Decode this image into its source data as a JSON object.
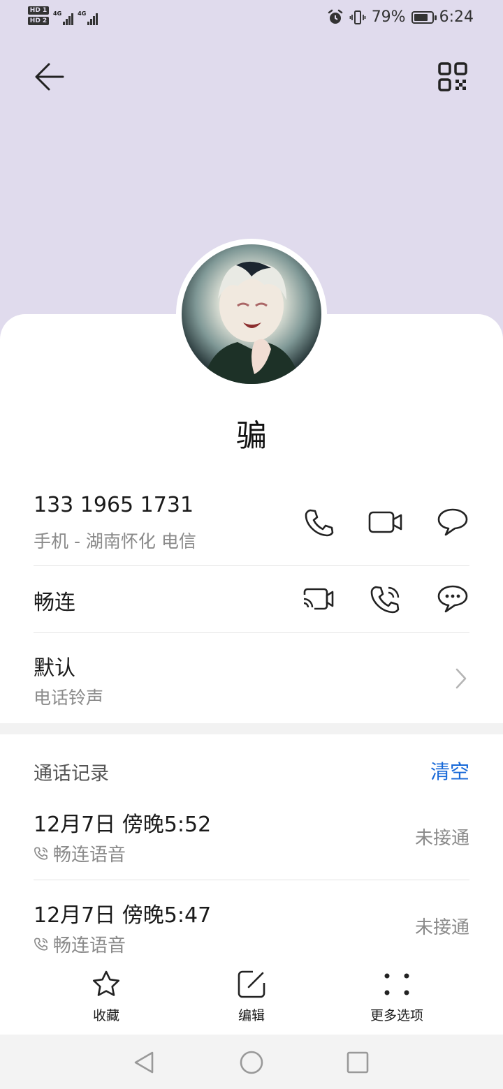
{
  "status_bar": {
    "sim1": "HD 1",
    "sim2": "HD 2",
    "net1": "4G",
    "net2": "4G",
    "battery_percent": "79%",
    "battery_level": 0.79,
    "time": "6:24"
  },
  "header": {
    "back_icon": "arrow-left-icon",
    "qr_icon": "qr-code-icon"
  },
  "contact": {
    "name": "骗",
    "phone_number": "133 1965 1731",
    "phone_label": "手机 - 湖南怀化 电信",
    "changlian_label": "畅连",
    "ringtone_value": "默认",
    "ringtone_label": "电话铃声"
  },
  "call_log": {
    "title": "通话记录",
    "clear_label": "清空",
    "entries": [
      {
        "time": "12月7日 傍晚5:52",
        "type": "畅连语音",
        "status": "未接通"
      },
      {
        "time": "12月7日 傍晚5:47",
        "type": "畅连语音",
        "status": "未接通"
      }
    ]
  },
  "bottom_actions": {
    "favorite": "收藏",
    "edit": "编辑",
    "more": "更多选项"
  },
  "colors": {
    "header_bg": "#e0dbed",
    "accent": "#1869d8"
  }
}
